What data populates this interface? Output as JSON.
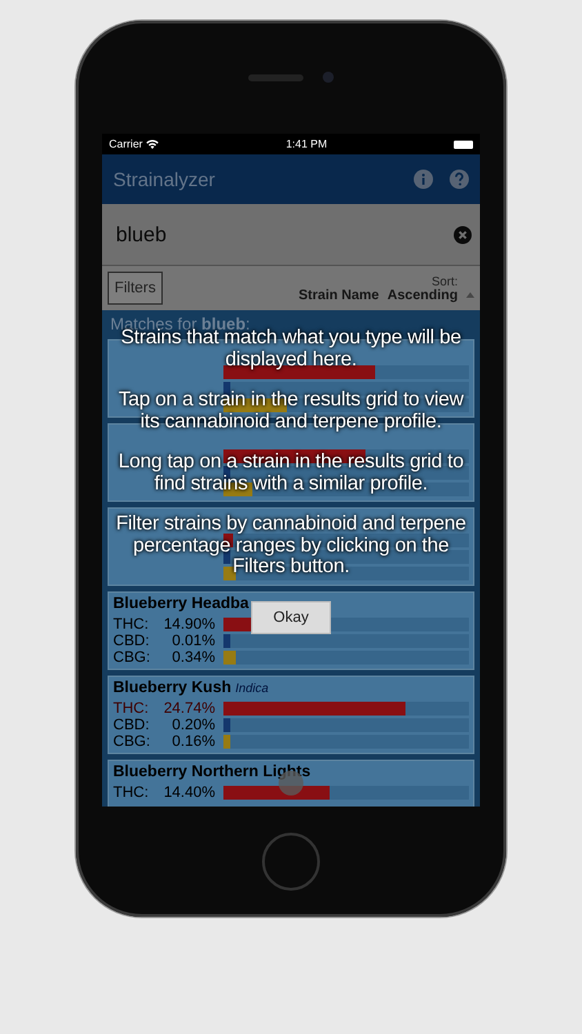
{
  "status_bar": {
    "carrier": "Carrier",
    "time": "1:41 PM"
  },
  "nav": {
    "title": "Strainalyzer"
  },
  "search": {
    "value": "blueb"
  },
  "filters_button": "Filters",
  "sort": {
    "label": "Sort:",
    "field": "Strain Name",
    "order": "Ascending"
  },
  "matches_header": "Matches for **blueb**:",
  "strains": [
    {
      "rows": [
        {
          "kind": "thc",
          "level": 0.62
        },
        {
          "kind": "cbd",
          "level": 0.03
        },
        {
          "kind": "cbg",
          "level": 0.26
        }
      ]
    },
    {
      "rows": [
        {
          "kind": "thc",
          "level": 0.58
        },
        {
          "kind": "cbd",
          "level": 0.03
        },
        {
          "kind": "cbg",
          "level": 0.12
        }
      ]
    },
    {
      "rows": [
        {
          "kind": "thc",
          "level": 0.04
        },
        {
          "kind": "cbd",
          "level": 0.03
        },
        {
          "kind": "cbg",
          "level": 0.05
        }
      ]
    },
    {
      "name": "Blueberry Headba",
      "rows": [
        {
          "kind": "thc",
          "label": "THC:",
          "value": "14.90%",
          "high": false,
          "level": 0.44
        },
        {
          "kind": "cbd",
          "label": "CBD:",
          "value": "0.01%",
          "high": false,
          "level": 0.03
        },
        {
          "kind": "cbg",
          "label": "CBG:",
          "value": "0.34%",
          "high": false,
          "level": 0.05
        }
      ]
    },
    {
      "name": "Blueberry Kush",
      "type": "Indica",
      "rows": [
        {
          "kind": "thc",
          "label": "THC:",
          "value": "24.74%",
          "high": true,
          "level": 0.74
        },
        {
          "kind": "cbd",
          "label": "CBD:",
          "value": "0.20%",
          "high": false,
          "level": 0.03
        },
        {
          "kind": "cbg",
          "label": "CBG:",
          "value": "0.16%",
          "high": false,
          "level": 0.03
        }
      ]
    },
    {
      "name": "Blueberry Northern Lights",
      "rows": [
        {
          "kind": "thc",
          "label": "THC:",
          "value": "14.40%",
          "high": false,
          "level": 0.43
        }
      ]
    }
  ],
  "overlay": {
    "messages": [
      "Strains that match what you type will be displayed here.",
      "Tap on a strain in the results grid to view its cannabinoid and terpene profile.",
      "Long tap on a strain in the results grid to find strains with a similar profile.",
      "Filter strains by cannabinoid and terpene percentage ranges by clicking on the Filters button."
    ],
    "button": "Okay"
  }
}
